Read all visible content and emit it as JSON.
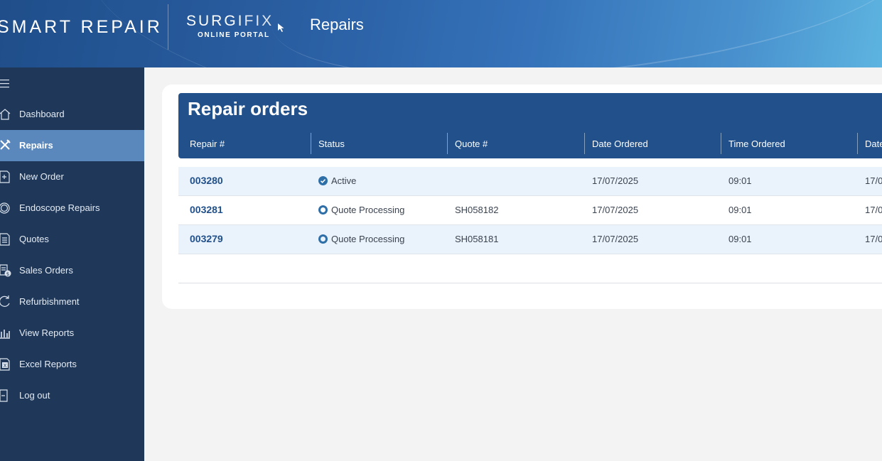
{
  "header": {
    "logo_smart": "SMART REPAIR",
    "logo_surgifix_main_a": "SURGI",
    "logo_surgifix_main_b": "FIX",
    "logo_surgifix_sub": "ONLINE PORTAL",
    "page_title": "Repairs"
  },
  "sidebar": {
    "items": [
      {
        "label": "Dashboard",
        "icon": "home-icon"
      },
      {
        "label": "Repairs",
        "icon": "tools-icon",
        "active": true
      },
      {
        "label": "New Order",
        "icon": "new-order-icon"
      },
      {
        "label": "Endoscope Repairs",
        "icon": "endoscope-icon"
      },
      {
        "label": "Quotes",
        "icon": "quote-icon"
      },
      {
        "label": "Sales Orders",
        "icon": "sales-order-icon"
      },
      {
        "label": "Refurbishment",
        "icon": "refresh-icon"
      },
      {
        "label": "View Reports",
        "icon": "bar-chart-icon"
      },
      {
        "label": "Excel Reports",
        "icon": "excel-icon"
      },
      {
        "label": "Log out",
        "icon": "logout-icon"
      }
    ]
  },
  "table": {
    "title": "Repair orders",
    "columns": [
      "Repair #",
      "Status",
      "Quote #",
      "Date Ordered",
      "Time Ordered",
      "Date"
    ],
    "rows": [
      {
        "repair": "003280",
        "status": "Active",
        "status_type": "active",
        "quote": "",
        "date": "17/07/2025",
        "time": "09:01",
        "date2": "17/0"
      },
      {
        "repair": "003281",
        "status": "Quote Processing",
        "status_type": "processing",
        "quote": "SH058182",
        "date": "17/07/2025",
        "time": "09:01",
        "date2": "17/0"
      },
      {
        "repair": "003279",
        "status": "Quote Processing",
        "status_type": "processing",
        "quote": "SH058181",
        "date": "17/07/2025",
        "time": "09:01",
        "date2": "17/0"
      }
    ]
  },
  "colors": {
    "sidebar_bg": "#1f3859",
    "active_item": "#5a88bd",
    "table_head": "#21508a",
    "status_blue": "#2f6fa8"
  }
}
